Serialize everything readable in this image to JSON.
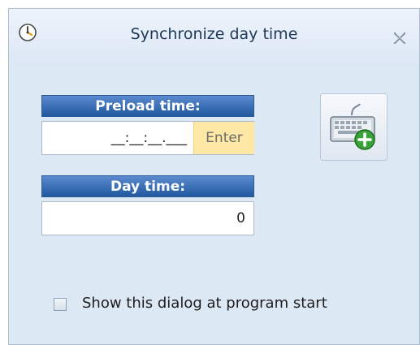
{
  "window": {
    "title": "Synchronize day time",
    "title_icon": "clock-icon",
    "close_icon": "close-icon"
  },
  "preload_time": {
    "label": "Preload time:",
    "value": "__:__:__.___",
    "enter_label": "Enter"
  },
  "day_time": {
    "label": "Day time:",
    "value": "0"
  },
  "keyboard_button": {
    "icon": "keyboard-add-icon"
  },
  "startup_option": {
    "label": "Show this dialog at program start",
    "checked": false
  },
  "colors": {
    "header_blue": "#20589e",
    "enter_yellow": "#fde9a5",
    "panel_bg": "#dde8f5",
    "plus_green": "#3aa23a"
  }
}
